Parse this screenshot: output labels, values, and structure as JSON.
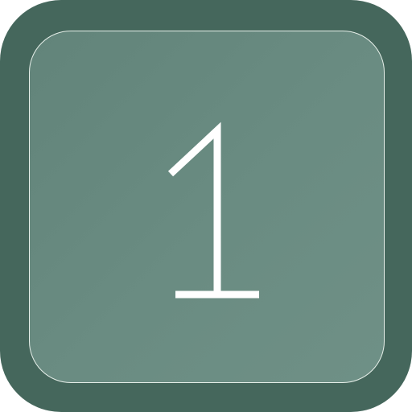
{
  "icon": {
    "digit": "1",
    "frame_color": "#45675c",
    "inner_color": "#6a8c82",
    "glyph_color": "#ffffff",
    "border_color": "#e6efe9"
  }
}
